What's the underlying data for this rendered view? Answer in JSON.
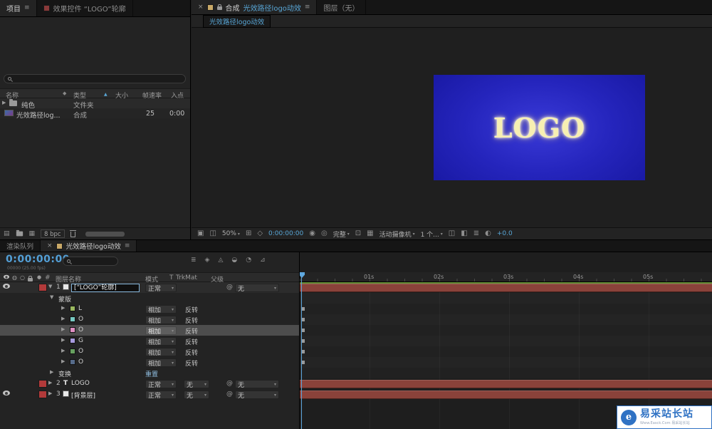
{
  "colors": {
    "accent": "#539fd6",
    "bar_red": "#8a423a",
    "work_green": "#618c33",
    "label_red": "#b23a3a",
    "viewport_blue": "#2525bd"
  },
  "icons": {
    "menu": "≡",
    "close": "×",
    "caret_down": "▾",
    "expand_open": "▼",
    "expand_closed": "▶",
    "sort_asc": "▲",
    "label_diamond": "◆",
    "label_dot": "●",
    "audio": "◍",
    "solo": "○",
    "pickwhip": "@",
    "text_layer": "T",
    "always_preview": "▣",
    "channels": "◫",
    "grid_guides": "⊞",
    "mask_visibility": "◇",
    "snapshot": "◉",
    "show_snapshot": "◎",
    "roi": "⊡",
    "transparency_grid": "▦",
    "pixel_aspect": "◫",
    "fast_previews": "◧",
    "exposure": "◐",
    "flowchart": "≣",
    "draft3d": "◈",
    "shy": "◬",
    "frame_blend": "◒",
    "motion_blur": "◔",
    "graph_editor": "⊿",
    "interpret": "▤",
    "new_comp": "▦"
  },
  "project": {
    "tab_project": "项目",
    "tab_effect_controls": "效果控件 “LOGO”轮廓",
    "columns": {
      "name": "名称",
      "type": "类型",
      "size": "大小",
      "framerate": "帧速率",
      "inpoint": "入点"
    },
    "rows": [
      {
        "name": "纯色",
        "type": "文件夹",
        "framerate": "",
        "inpoint": ""
      },
      {
        "name": "光效路径log...",
        "type": "合成",
        "framerate": "25",
        "inpoint": "0:00"
      }
    ],
    "bpc": "8 bpc"
  },
  "viewer": {
    "tab_comp_prefix": "合成",
    "tab_comp_name": "光效路径logo动效",
    "tab_layer": "图层（无）",
    "subtab": "光效路径logo动效",
    "logo_text": "LOGO",
    "zoom": "50%",
    "timecode": "0:00:00:00",
    "resolution": "完整",
    "camera": "活动摄像机",
    "views": "1 个...",
    "exposure": "+0.0"
  },
  "timeline": {
    "tab_render_queue": "渲染队列",
    "tab_comp": "光效路径logo动效",
    "timecode": "0:00:00:00",
    "timecode_sub": "00000 (25.00 fps)",
    "col_num": "#",
    "col_layer_name": "图层名称",
    "col_mode": "模式",
    "col_t": "T",
    "col_trkmat": "TrkMat",
    "col_parent": "父级",
    "mask_group_label": "蒙版",
    "transform_label": "变换",
    "transform_reset": "重置",
    "layers": [
      {
        "num": "1",
        "name": "[“LOGO”轮廓]",
        "mode": "正常",
        "trkmat": "",
        "parent": "无"
      },
      {
        "num": "2",
        "name": "LOGO",
        "mode": "正常",
        "trkmat": "无",
        "parent": "无"
      },
      {
        "num": "3",
        "name": "[背景层]",
        "mode": "正常",
        "trkmat": "无",
        "parent": "无"
      }
    ],
    "masks": [
      {
        "label": "L",
        "mode": "相加",
        "invert": "反转",
        "color": "#9ab85f"
      },
      {
        "label": "O",
        "mode": "相加",
        "invert": "反转",
        "color": "#77c9c2"
      },
      {
        "label": "O",
        "mode": "相加",
        "invert": "反转",
        "color": "#df8fc2"
      },
      {
        "label": "G",
        "mode": "相加",
        "invert": "反转",
        "color": "#a79ade"
      },
      {
        "label": "O",
        "mode": "相加",
        "invert": "反转",
        "color": "#67a05f"
      },
      {
        "label": "O",
        "mode": "相加",
        "invert": "反转",
        "color": "#566b8a"
      }
    ],
    "ruler": [
      "01s",
      "02s",
      "03s",
      "04s",
      "05s"
    ]
  },
  "watermark": {
    "logo_letter": "e",
    "title": "易采站长站",
    "subtitle": "Www.Easck.Com 易采站长站"
  }
}
